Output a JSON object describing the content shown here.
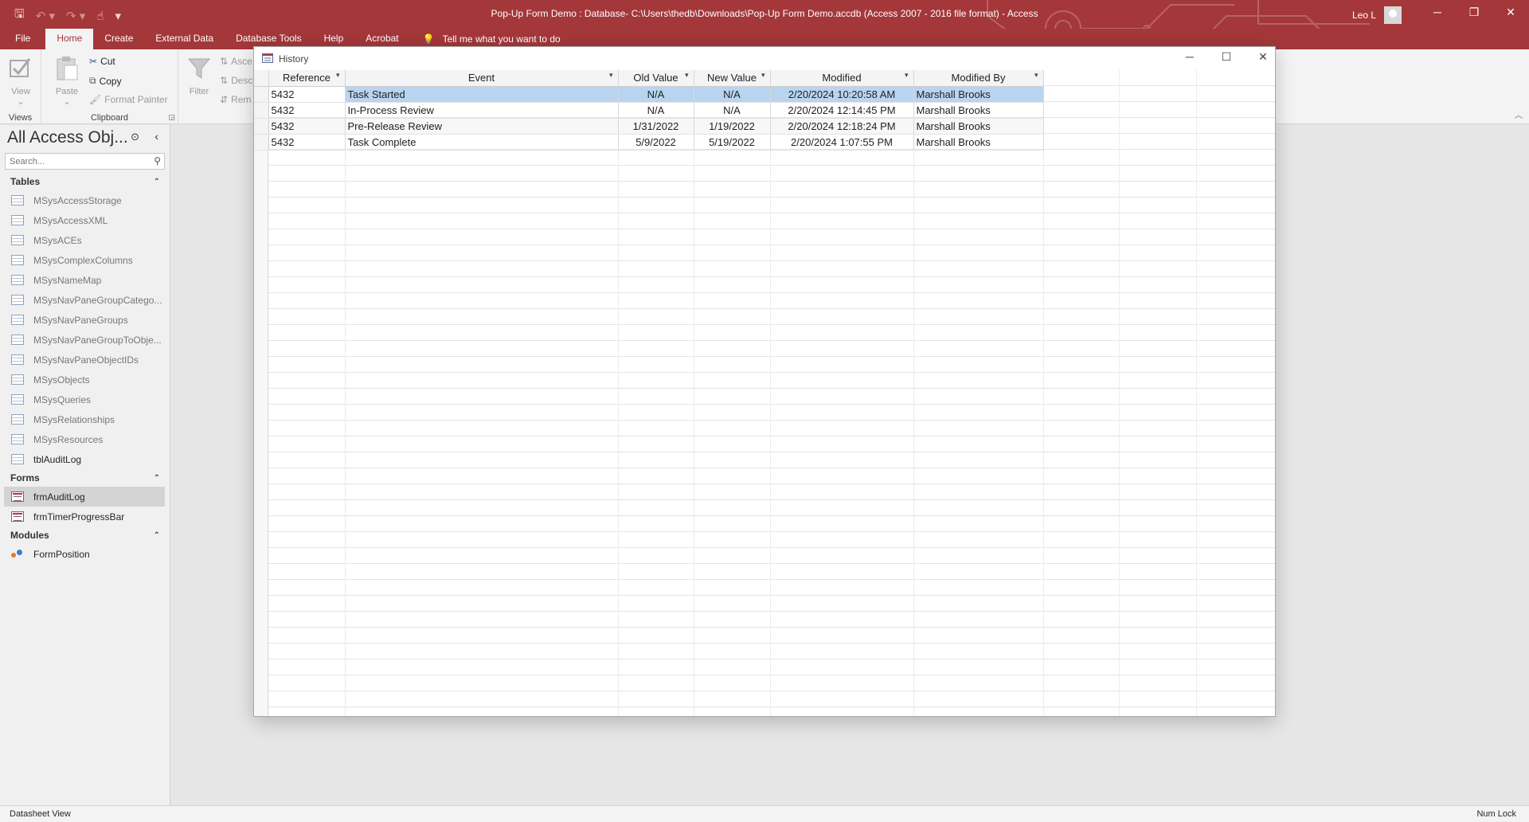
{
  "app": {
    "window_title": "Pop-Up Form Demo : Database- C:\\Users\\thedb\\Downloads\\Pop-Up Form Demo.accdb (Access 2007 - 2016 file format)  -  Access",
    "user_name": "Leo L",
    "accent_color": "#a4373a"
  },
  "ribbon": {
    "tabs": [
      "File",
      "Home",
      "Create",
      "External Data",
      "Database Tools",
      "Help",
      "Acrobat"
    ],
    "active_tab": "Home",
    "tell_me": "Tell me what you want to do",
    "views": {
      "view_label": "View",
      "group_label": "Views"
    },
    "clipboard": {
      "paste_label": "Paste",
      "cut_label": "Cut",
      "copy_label": "Copy",
      "format_painter_label": "Format Painter",
      "group_label": "Clipboard"
    },
    "sort_filter": {
      "filter_label": "Filter",
      "ascending_label": "Asce",
      "descending_label": "Desc",
      "remove_label": "Rem"
    }
  },
  "nav_pane": {
    "title": "All Access Obj...",
    "search_placeholder": "Search...",
    "sections": [
      {
        "label": "Tables",
        "items": [
          {
            "label": "MSysAccessStorage",
            "system": true
          },
          {
            "label": "MSysAccessXML",
            "system": true
          },
          {
            "label": "MSysACEs",
            "system": true
          },
          {
            "label": "MSysComplexColumns",
            "system": true
          },
          {
            "label": "MSysNameMap",
            "system": true
          },
          {
            "label": "MSysNavPaneGroupCatego...",
            "system": true
          },
          {
            "label": "MSysNavPaneGroups",
            "system": true
          },
          {
            "label": "MSysNavPaneGroupToObje...",
            "system": true
          },
          {
            "label": "MSysNavPaneObjectIDs",
            "system": true
          },
          {
            "label": "MSysObjects",
            "system": true
          },
          {
            "label": "MSysQueries",
            "system": true
          },
          {
            "label": "MSysRelationships",
            "system": true
          },
          {
            "label": "MSysResources",
            "system": true
          },
          {
            "label": "tblAuditLog",
            "system": false
          }
        ]
      },
      {
        "label": "Forms",
        "items": [
          {
            "label": "frmAuditLog",
            "selected": true
          },
          {
            "label": "frmTimerProgressBar"
          }
        ]
      },
      {
        "label": "Modules",
        "items": [
          {
            "label": "FormPosition"
          }
        ]
      }
    ]
  },
  "popup": {
    "title": "History",
    "columns": [
      "Reference",
      "Event",
      "Old Value",
      "New Value",
      "Modified",
      "Modified By"
    ],
    "rows": [
      [
        "5432",
        "Task Started",
        "N/A",
        "N/A",
        "2/20/2024 10:20:58 AM",
        "Marshall Brooks"
      ],
      [
        "5432",
        "In-Process Review",
        "N/A",
        "N/A",
        "2/20/2024 12:14:45 PM",
        "Marshall Brooks"
      ],
      [
        "5432",
        "Pre-Release Review",
        "1/31/2022",
        "1/19/2022",
        "2/20/2024 12:18:24 PM",
        "Marshall Brooks"
      ],
      [
        "5432",
        "Task Complete",
        "5/9/2022",
        "5/19/2022",
        "2/20/2024 1:07:55 PM",
        "Marshall Brooks"
      ]
    ],
    "selected_row": 0
  },
  "status": {
    "view": "Datasheet View",
    "num_lock": "Num Lock"
  }
}
